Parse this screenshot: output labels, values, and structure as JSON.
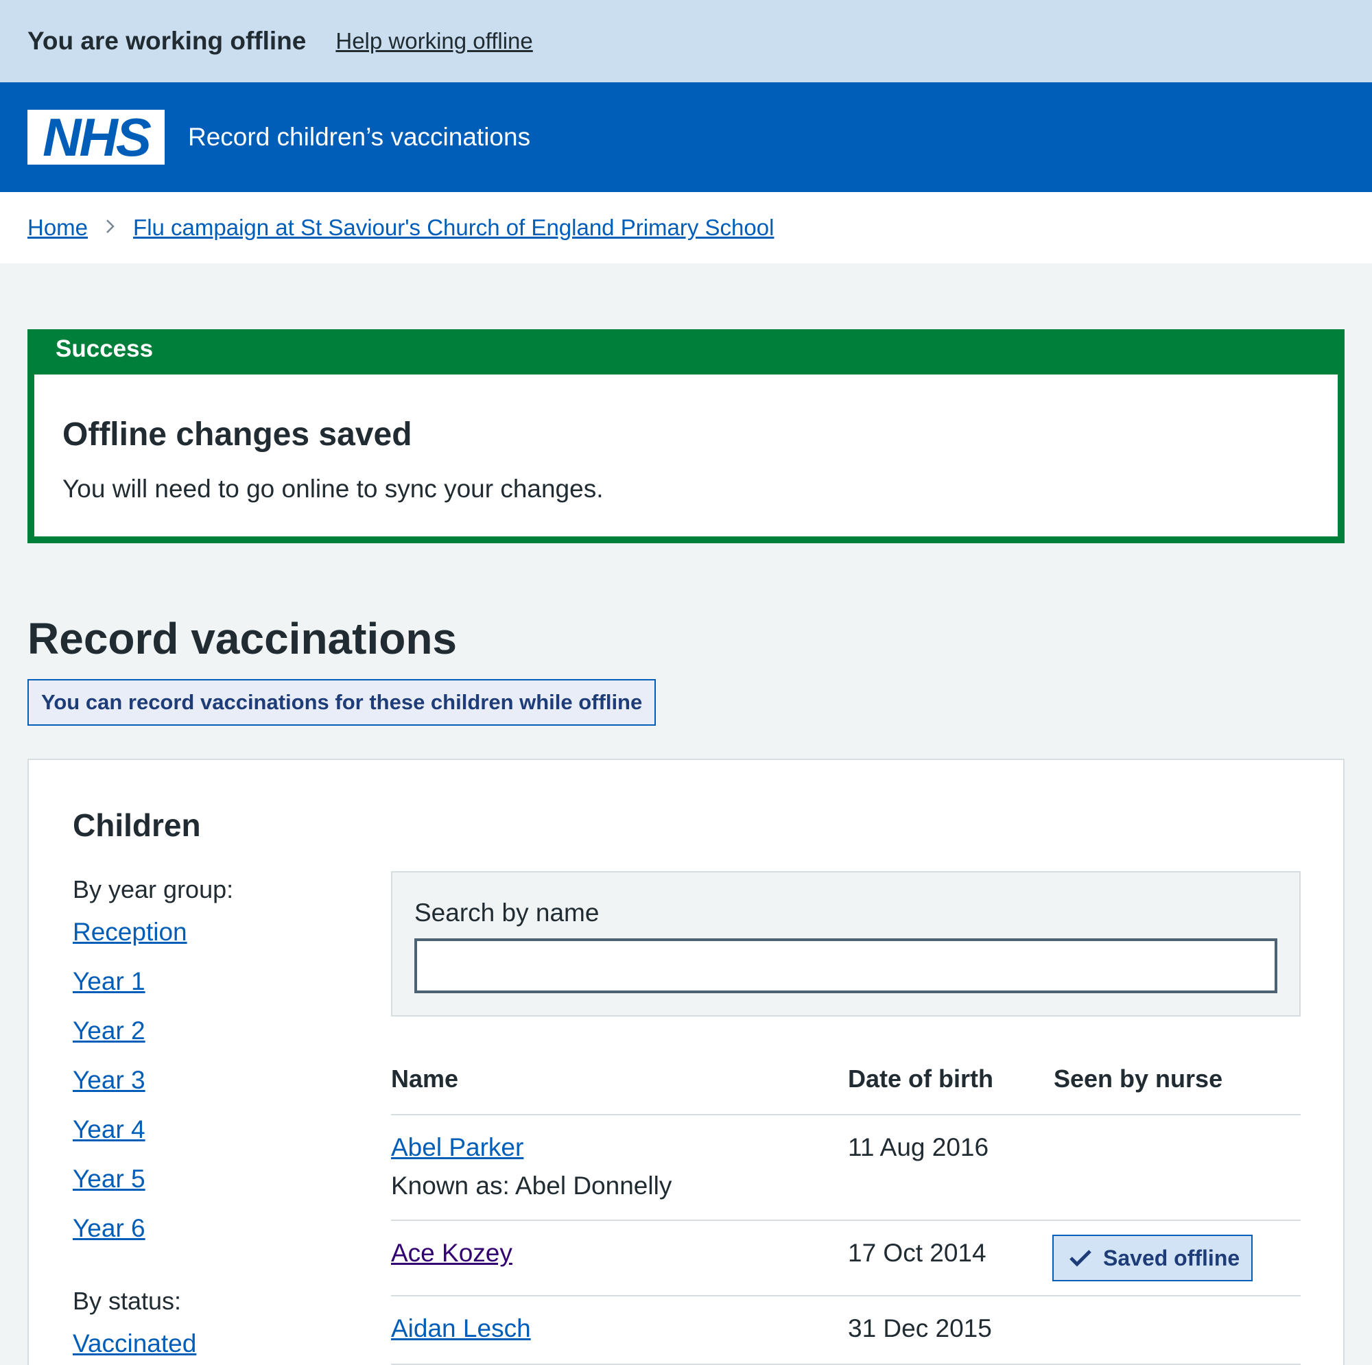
{
  "offline_banner": {
    "title": "You are working offline",
    "help_link": "Help working offline"
  },
  "header": {
    "logo": "NHS",
    "service_name": "Record children’s vaccinations"
  },
  "breadcrumb": {
    "items": [
      "Home",
      "Flu campaign at St Saviour's Church of England Primary School"
    ]
  },
  "success_banner": {
    "heading": "Success",
    "title": "Offline changes saved",
    "body": "You will need to go online to sync your changes."
  },
  "main": {
    "title": "Record vaccinations",
    "offline_tag": "You can record vaccinations for these children while offline"
  },
  "children": {
    "heading": "Children",
    "year_group_label": "By year group:",
    "year_groups": [
      "Reception",
      "Year 1",
      "Year 2",
      "Year 3",
      "Year 4",
      "Year 5",
      "Year 6"
    ],
    "status_label": "By status:",
    "statuses": [
      "Vaccinated"
    ],
    "search": {
      "label": "Search by name",
      "value": "",
      "placeholder": ""
    },
    "table": {
      "headers": [
        "Name",
        "Date of birth",
        "Seen by nurse"
      ],
      "rows": [
        {
          "name": "Abel Parker",
          "known_as": "Known as: Abel Donnelly",
          "dob": "11 Aug 2016",
          "seen": ""
        },
        {
          "name": "Ace Kozey",
          "known_as": "",
          "dob": "17 Oct 2014",
          "seen": "Saved offline"
        },
        {
          "name": "Aidan Lesch",
          "known_as": "",
          "dob": "31 Dec 2015",
          "seen": ""
        }
      ]
    }
  },
  "colors": {
    "nhs_blue": "#005eb8",
    "success_green": "#007f3b",
    "offline_bar": "#cadeef",
    "page_bg": "#f0f4f5",
    "visited_link": "#330072"
  },
  "icons": {
    "saved_offline": "check-icon",
    "breadcrumb_separator": "chevron-right-icon"
  }
}
